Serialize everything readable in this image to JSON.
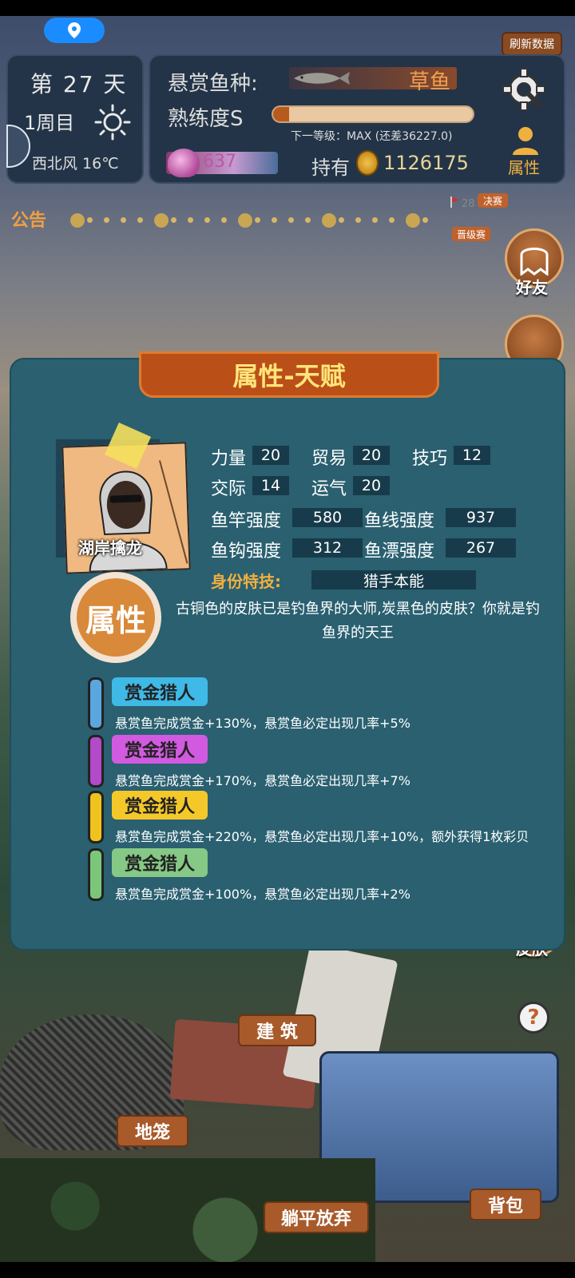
{
  "header": {
    "refresh_label": "刷新数据"
  },
  "day_card": {
    "day": "第 27 天",
    "week": "1周目",
    "wind": "西北风 16℃",
    "weather_icon": "sun-icon"
  },
  "bounty_card": {
    "bounty_label": "悬赏鱼种:",
    "fish_name": "草鱼",
    "skill_label": "熟练度S",
    "skill_progress": 0.08,
    "next_level": "下一等级：MAX (还差36227.0)",
    "gems": "637",
    "hold_label": "持有",
    "gold": "1126175",
    "attribute_label": "属性"
  },
  "notice": {
    "label": "公告",
    "flag_number": "28",
    "final_label": "决赛",
    "promotion_label": "晋级赛"
  },
  "side_buttons": {
    "friends": "好友",
    "skin": "皮肤",
    "help": "?"
  },
  "modal": {
    "title": "属性-天赋",
    "avatar_name": "湖岸擒龙",
    "stats": {
      "strength_label": "力量",
      "strength": "20",
      "trade_label": "贸易",
      "trade": "20",
      "skill_label": "技巧",
      "skill": "12",
      "social_label": "交际",
      "social": "14",
      "luck_label": "运气",
      "luck": "20",
      "rod_label": "鱼竿强度",
      "rod": "580",
      "line_label": "鱼线强度",
      "line": "937",
      "hook_label": "鱼钩强度",
      "hook": "312",
      "float_label": "鱼漂强度",
      "float": "267"
    },
    "identity_label": "身份特技:",
    "identity_value": "猎手本能",
    "attr_badge": "属性",
    "description": "古铜色的皮肤已是钓鱼界的大师,炭黑色的皮肤？你就是钓鱼界的天王",
    "talents": [
      {
        "name": "赏金猎人",
        "desc": "悬赏鱼完成赏金+130%，悬赏鱼必定出现几率+5%",
        "color": "#5aa7e0",
        "tag_color": "#3fb9e6"
      },
      {
        "name": "赏金猎人",
        "desc": "悬赏鱼完成赏金+170%，悬赏鱼必定出现几率+7%",
        "color": "#b34ac7",
        "tag_color": "#d15ae0"
      },
      {
        "name": "赏金猎人",
        "desc": "悬赏鱼完成赏金+220%，悬赏鱼必定出现几率+10%，额外获得1枚彩贝",
        "color": "#f0c21e",
        "tag_color": "#f5c82a"
      },
      {
        "name": "赏金猎人",
        "desc": "悬赏鱼完成赏金+100%，悬赏鱼必定出现几率+2%",
        "color": "#7bc77a",
        "tag_color": "#86c886"
      }
    ]
  },
  "actions": {
    "build": "建 筑",
    "cage": "地笼",
    "give_up": "躺平放弃",
    "bag": "背包"
  }
}
